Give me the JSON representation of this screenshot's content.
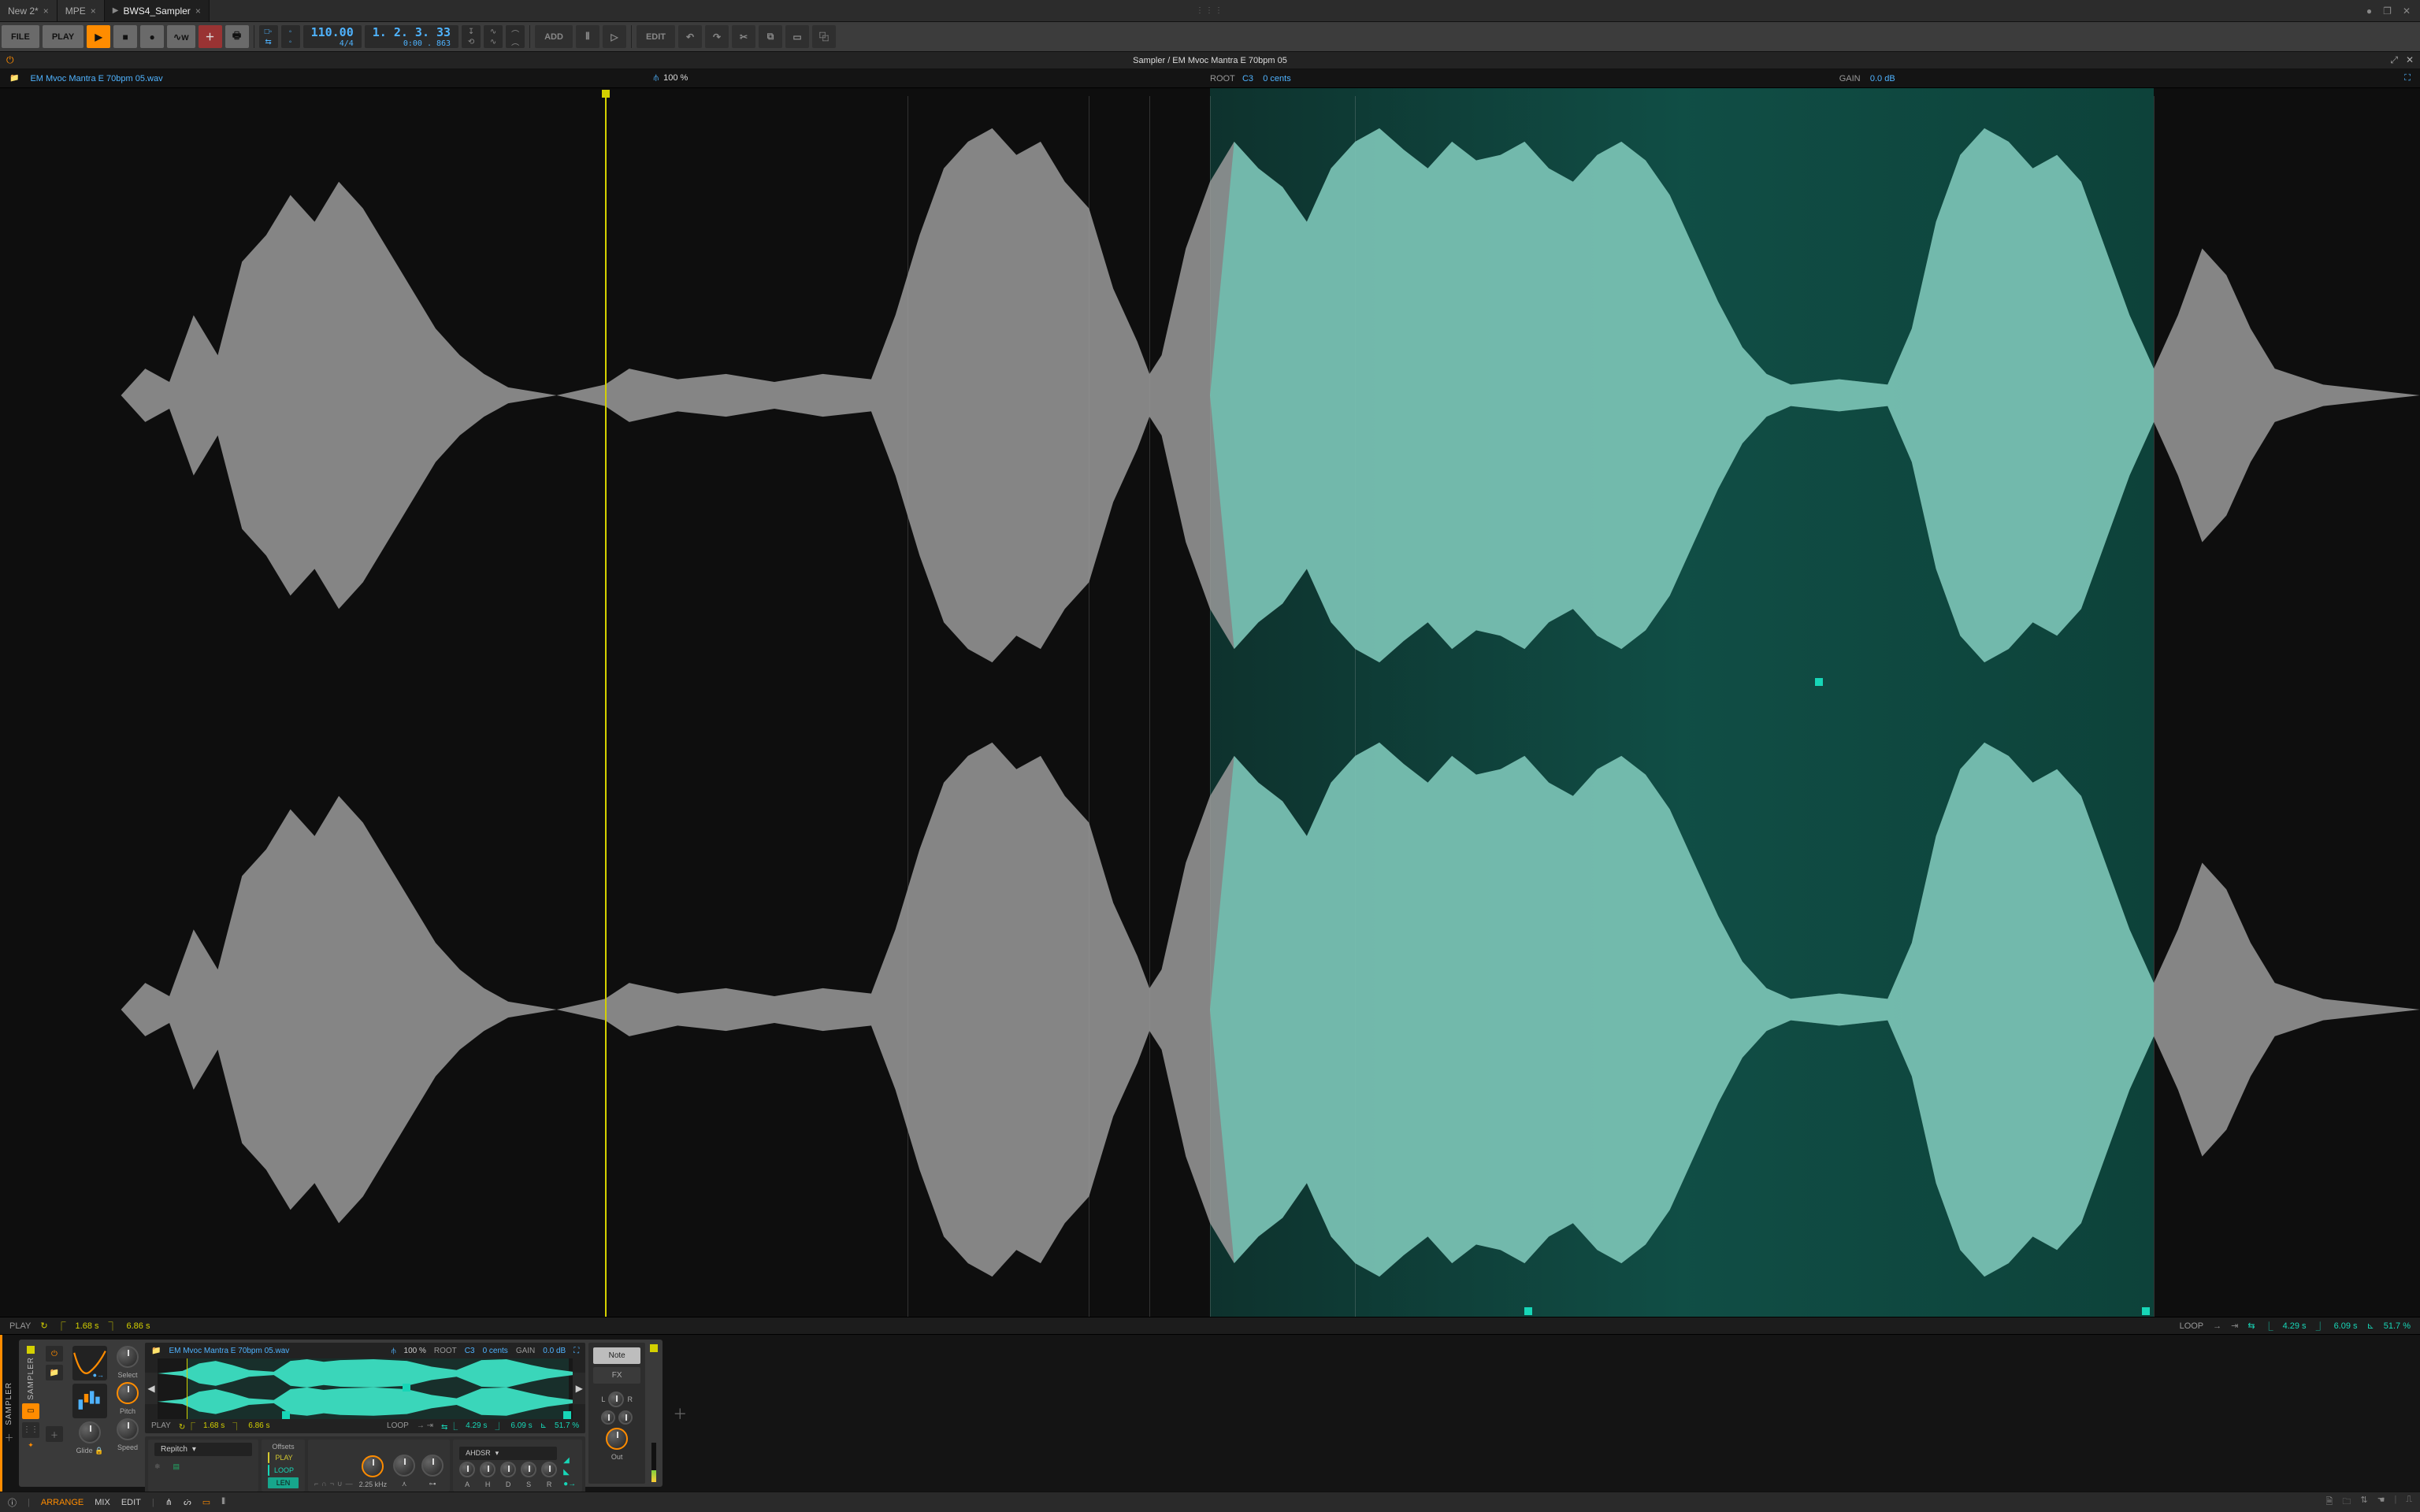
{
  "tabs": [
    {
      "label": "New 2*",
      "active": false,
      "playing": false
    },
    {
      "label": "MPE",
      "active": false,
      "playing": false
    },
    {
      "label": "BWS4_Sampler",
      "active": true,
      "playing": true
    }
  ],
  "toolbar": {
    "file": "FILE",
    "play": "PLAY",
    "add": "ADD",
    "edit": "EDIT"
  },
  "transport": {
    "tempo": "110.00",
    "time_sig": "4/4",
    "position": "1. 2. 3. 33",
    "clock": "0:00 . 863"
  },
  "editor": {
    "title": "Sampler / EM Mvoc Mantra E 70bpm 05",
    "filename": "EM Mvoc Mantra E 70bpm 05.wav",
    "zoom": "100 %",
    "root_label": "ROOT",
    "root_note": "C3",
    "root_cents": "0 cents",
    "gain_label": "GAIN",
    "gain_value": "0.0 dB"
  },
  "status": {
    "play_label": "PLAY",
    "play_start": "1.68 s",
    "play_end": "6.86 s",
    "loop_label": "LOOP",
    "loop_start": "4.29 s",
    "loop_end": "6.09 s",
    "loop_len": "51.7 %"
  },
  "device": {
    "name": "SAMPLER",
    "inner_name": "SAMPLER",
    "filename": "EM Mvoc Mantra E 70bpm 05.wav",
    "zoom": "100 %",
    "root_label": "ROOT",
    "root_note": "C3",
    "root_cents": "0 cents",
    "gain_label": "GAIN",
    "gain_value": "0.0 dB",
    "knobs": {
      "select": "Select",
      "pitch": "Pitch",
      "glide": "Glide",
      "speed": "Speed",
      "out": "Out"
    },
    "mode": "Repitch",
    "offsets_label": "Offsets",
    "offsets": {
      "play": "PLAY",
      "loop": "LOOP",
      "len": "LEN"
    },
    "filter_freq": "2.25 kHz",
    "env_label": "AHDSR",
    "env": [
      "A",
      "H",
      "D",
      "S",
      "R"
    ],
    "note_tab": "Note",
    "fx_tab": "FX",
    "pan_l": "L",
    "pan_r": "R",
    "play_label": "PLAY",
    "play_start": "1.68 s",
    "play_end": "6.86 s",
    "loop_label": "LOOP",
    "loop_start": "4.29 s",
    "loop_end": "6.09 s",
    "loop_len": "51.7 %"
  },
  "bottombar": {
    "arrange": "ARRANGE",
    "mix": "MIX",
    "edit": "EDIT"
  }
}
